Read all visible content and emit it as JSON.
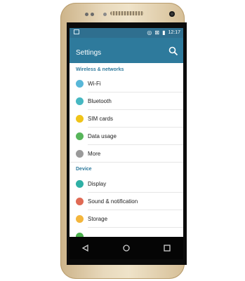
{
  "status_bar": {
    "time": "12:17"
  },
  "app_bar": {
    "title": "Settings",
    "search_icon": "search-icon"
  },
  "sections": [
    {
      "title": "Wireless & networks",
      "items": [
        {
          "label": "Wi-Fi",
          "icon": "wifi-icon",
          "color": "#58b7d8"
        },
        {
          "label": "Bluetooth",
          "icon": "bluetooth-icon",
          "color": "#46b8c2"
        },
        {
          "label": "SIM cards",
          "icon": "sim-card-icon",
          "color": "#f0c419"
        },
        {
          "label": "Data usage",
          "icon": "data-usage-icon",
          "color": "#57b55a"
        },
        {
          "label": "More",
          "icon": "more-icon",
          "color": "#9a9a9a"
        }
      ]
    },
    {
      "title": "Device",
      "items": [
        {
          "label": "Display",
          "icon": "display-icon",
          "color": "#2fb0a5"
        },
        {
          "label": "Sound & notification",
          "icon": "sound-icon",
          "color": "#e06a54"
        },
        {
          "label": "Storage",
          "icon": "storage-icon",
          "color": "#f4b63c"
        },
        {
          "label": "",
          "icon": "next-item-icon",
          "color": "#4bb04d"
        }
      ]
    }
  ],
  "nav_bar": {
    "back_icon": "back-icon",
    "home_icon": "home-icon",
    "recents_icon": "recents-icon"
  },
  "colors": {
    "accent": "#2e7a9c",
    "status_bar": "#2f6f8f",
    "phone_body": "#e8d9bc"
  }
}
